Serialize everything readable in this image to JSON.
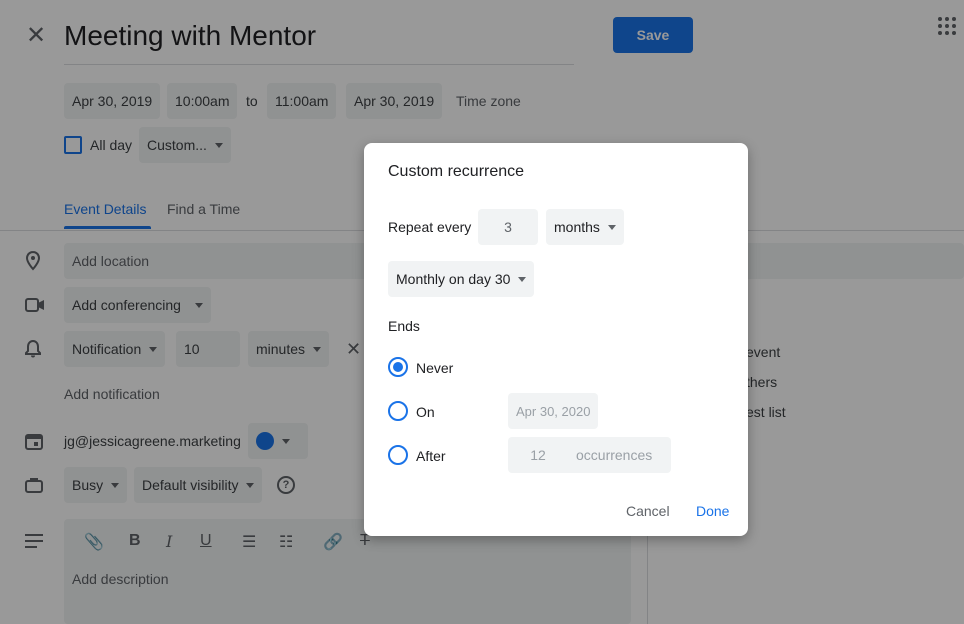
{
  "header": {
    "title": "Meeting with Mentor",
    "save_label": "Save"
  },
  "datetime": {
    "start_date": "Apr 30, 2019",
    "start_time": "10:00am",
    "to_label": "to",
    "end_time": "11:00am",
    "end_date": "Apr 30, 2019",
    "timezone_label": "Time zone",
    "all_day_label": "All day",
    "repeat_value": "Custom..."
  },
  "tabs": {
    "event_details": "Event Details",
    "find_a_time": "Find a Time"
  },
  "details": {
    "location_placeholder": "Add location",
    "conferencing_label": "Add conferencing",
    "notification_type": "Notification",
    "notification_value": "10",
    "notification_unit": "minutes",
    "add_notification_label": "Add notification",
    "calendar_owner": "jg@jessicagreene.marketing",
    "calendar_color": "#1a73e8",
    "busy_value": "Busy",
    "visibility_value": "Default visibility",
    "description_placeholder": "Add description"
  },
  "guest_panel": {
    "line1_partial": "event",
    "line2_partial": "thers",
    "line3_partial": "est list"
  },
  "dialog": {
    "title": "Custom recurrence",
    "repeat_every_label": "Repeat every",
    "repeat_interval": "3",
    "repeat_unit": "months",
    "monthly_option": "Monthly on day 30",
    "ends_label": "Ends",
    "never_label": "Never",
    "on_label": "On",
    "on_date": "Apr 30, 2020",
    "after_label": "After",
    "after_count": "12",
    "occurrences_label": "occurrences",
    "cancel_label": "Cancel",
    "done_label": "Done",
    "selected_end": "Never"
  },
  "colors": {
    "accent": "#1a73e8",
    "chip_bg": "#f1f3f4"
  }
}
